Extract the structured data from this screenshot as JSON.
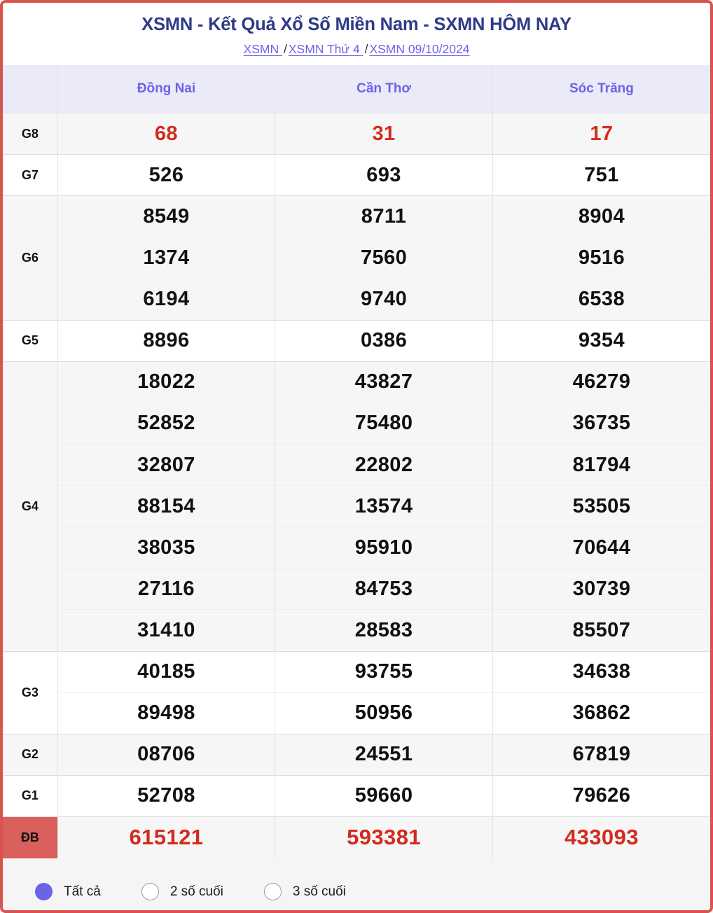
{
  "header": {
    "title": "XSMN - Kết Quả Xổ Số Miền Nam - SXMN HÔM NAY",
    "breadcrumb": [
      {
        "label": "XSMN "
      },
      {
        "label": "XSMN Thứ 4 "
      },
      {
        "label": "XSMN 09/10/2024"
      }
    ],
    "separator": "/"
  },
  "table": {
    "label_column_header": "",
    "provinces": [
      "Đồng Nai",
      "Cần Thơ",
      "Sóc Trăng"
    ],
    "rows": [
      {
        "prize": "G8",
        "stripe": true,
        "highlight": "red",
        "values": [
          [
            "68"
          ],
          [
            "31"
          ],
          [
            "17"
          ]
        ]
      },
      {
        "prize": "G7",
        "stripe": false,
        "highlight": "none",
        "values": [
          [
            "526"
          ],
          [
            "693"
          ],
          [
            "751"
          ]
        ]
      },
      {
        "prize": "G6",
        "stripe": true,
        "highlight": "none",
        "values": [
          [
            "8549",
            "1374",
            "6194"
          ],
          [
            "8711",
            "7560",
            "9740"
          ],
          [
            "8904",
            "9516",
            "6538"
          ]
        ]
      },
      {
        "prize": "G5",
        "stripe": false,
        "highlight": "none",
        "values": [
          [
            "8896"
          ],
          [
            "0386"
          ],
          [
            "9354"
          ]
        ]
      },
      {
        "prize": "G4",
        "stripe": true,
        "highlight": "none",
        "values": [
          [
            "18022",
            "52852",
            "32807",
            "88154",
            "38035",
            "27116",
            "31410"
          ],
          [
            "43827",
            "75480",
            "22802",
            "13574",
            "95910",
            "84753",
            "28583"
          ],
          [
            "46279",
            "36735",
            "81794",
            "53505",
            "70644",
            "30739",
            "85507"
          ]
        ]
      },
      {
        "prize": "G3",
        "stripe": false,
        "highlight": "none",
        "values": [
          [
            "40185",
            "89498"
          ],
          [
            "93755",
            "50956"
          ],
          [
            "34638",
            "36862"
          ]
        ]
      },
      {
        "prize": "G2",
        "stripe": true,
        "highlight": "none",
        "values": [
          [
            "08706"
          ],
          [
            "24551"
          ],
          [
            "67819"
          ]
        ]
      },
      {
        "prize": "G1",
        "stripe": false,
        "highlight": "none",
        "values": [
          [
            "52708"
          ],
          [
            "59660"
          ],
          [
            "79626"
          ]
        ]
      },
      {
        "prize": "ĐB",
        "stripe": true,
        "highlight": "db",
        "values": [
          [
            "615121"
          ],
          [
            "593381"
          ],
          [
            "433093"
          ]
        ]
      }
    ]
  },
  "filters": {
    "options": [
      {
        "label": "Tất cả",
        "selected": true
      },
      {
        "label": "2 số cuối",
        "selected": false
      },
      {
        "label": "3 số cuối",
        "selected": false
      }
    ]
  },
  "colors": {
    "page_border": "#d9534f",
    "title": "#2e3a87",
    "link": "#6c63e8",
    "province_header_bg": "#ebeaf8",
    "province_header_text": "#6c63e8",
    "highlight_number": "#d42a1e",
    "db_badge_bg": "#d9605c",
    "radio_selected": "#6c63e8",
    "stripe_row_bg": "#f6f6f6",
    "footer_bg": "#f5f5f5"
  }
}
